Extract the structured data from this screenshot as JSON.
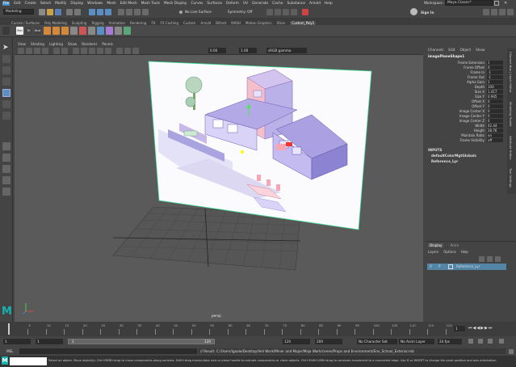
{
  "menubar": {
    "items": [
      "File",
      "Edit",
      "Create",
      "Select",
      "Modify",
      "Display",
      "Windows",
      "Mesh",
      "Edit Mesh",
      "Mesh Tools",
      "Mesh Display",
      "Curves",
      "Surfaces",
      "Deform",
      "UV",
      "Generate",
      "Cache",
      "Substance",
      "Arnold",
      "Help"
    ],
    "selection_name": "imagePlaneShape1",
    "workspace_label": "Workspace :",
    "workspace_value": "Maya Classic*",
    "sign_in": "Sign In"
  },
  "statusline": {
    "mode": "Modeling",
    "live_surface": "No Live Surface",
    "symmetry": "Symmetry: Off"
  },
  "shelf": {
    "tabs": [
      "Curves / Surfaces",
      "Poly Modeling",
      "Sculpting",
      "Rigging",
      "Animation",
      "Rendering",
      "FX",
      "FX Caching",
      "Custom",
      "Arnold",
      "Bifrost",
      "MASH",
      "Motion Graphics",
      "XGen",
      "Custom_Poly1"
    ],
    "active_tab": "Custom_Poly1",
    "icon_labels": [
      "Mel",
      "Tri",
      "Bnd"
    ]
  },
  "viewport": {
    "menu": [
      "View",
      "Shading",
      "Lighting",
      "Show",
      "Renderer",
      "Panels"
    ],
    "exposure": "0.00",
    "gamma": "1.00",
    "colorspace": "sRGB gamma",
    "camera_label": "persp"
  },
  "channelbox": {
    "menu": [
      "Channels",
      "Edit",
      "Object",
      "Show"
    ],
    "object_name": "imagePlaneShape1",
    "attributes": [
      {
        "name": "Frame Extension",
        "value": "1"
      },
      {
        "name": "Frame Offset",
        "value": "0"
      },
      {
        "name": "Frame In",
        "value": "-1"
      },
      {
        "name": "Frame Out",
        "value": "-1"
      },
      {
        "name": "Alpha Gain",
        "value": "1"
      },
      {
        "name": "Depth",
        "value": "100"
      },
      {
        "name": "Size X",
        "value": "1.417"
      },
      {
        "name": "Size Y",
        "value": "0.945"
      },
      {
        "name": "Offset X",
        "value": "0"
      },
      {
        "name": "Offset Y",
        "value": "0"
      },
      {
        "name": "Image Center X",
        "value": "0"
      },
      {
        "name": "Image Center Y",
        "value": "0"
      },
      {
        "name": "Image Center Z",
        "value": "0"
      },
      {
        "name": "Width",
        "value": "42.44"
      },
      {
        "name": "Height",
        "value": "28.76"
      },
      {
        "name": "Maintain Ratio",
        "value": "on"
      },
      {
        "name": "Frame Visibility",
        "value": "off"
      }
    ],
    "inputs_header": "INPUTS",
    "inputs": [
      "defaultColorMgtGlobals",
      "Reference_Lyr"
    ],
    "side_tabs": [
      "Channel Box / Layer Editor",
      "Modeling Toolkit",
      "Attribute Editor",
      "Tool Settings"
    ]
  },
  "layers": {
    "tabs": [
      "Display",
      "Anim"
    ],
    "menu": [
      "Layers",
      "Options",
      "Help"
    ],
    "row": {
      "v": "V",
      "p": "P",
      "name": "Reference_Lyr"
    }
  },
  "timeline": {
    "ticks": [
      "5",
      "10",
      "15",
      "20",
      "25",
      "30",
      "35",
      "40",
      "45",
      "50",
      "55",
      "60",
      "65",
      "70",
      "75",
      "80",
      "85",
      "90",
      "95",
      "100",
      "105",
      "110",
      "115",
      "120"
    ],
    "current_frame": "1"
  },
  "range": {
    "start": "1",
    "playback_start": "1",
    "range_start": "1",
    "range_end": "120",
    "playback_end": "120",
    "end": "200",
    "character_set": "No Character Set",
    "anim_layer": "No Anim Layer",
    "fps": "24 fps"
  },
  "cmdline": {
    "label": "MEL",
    "result": "// Result: C:/Users/lgaale/Desktop/Veli Work/Miner and Major/Maja Work/cenes/Props and Environment/Env_School_Exterior.mb"
  },
  "helpline": {
    "text": "Select an object. Move object(s). Ctrl+MMB+drag to move components along normals. Shift+drag manipulator axis or plane handle to extrude components or clone objects. Ctrl+Shift+LMB+drag to constrain movement to a connected edge. Use D or INSERT to change the pivot position and axis orientation."
  },
  "colors": {
    "accent_blue": "#4a8ec2",
    "maya_teal": "#18b3b0",
    "selected_layer": "#5285a6",
    "plane_border": "#44dd99"
  }
}
